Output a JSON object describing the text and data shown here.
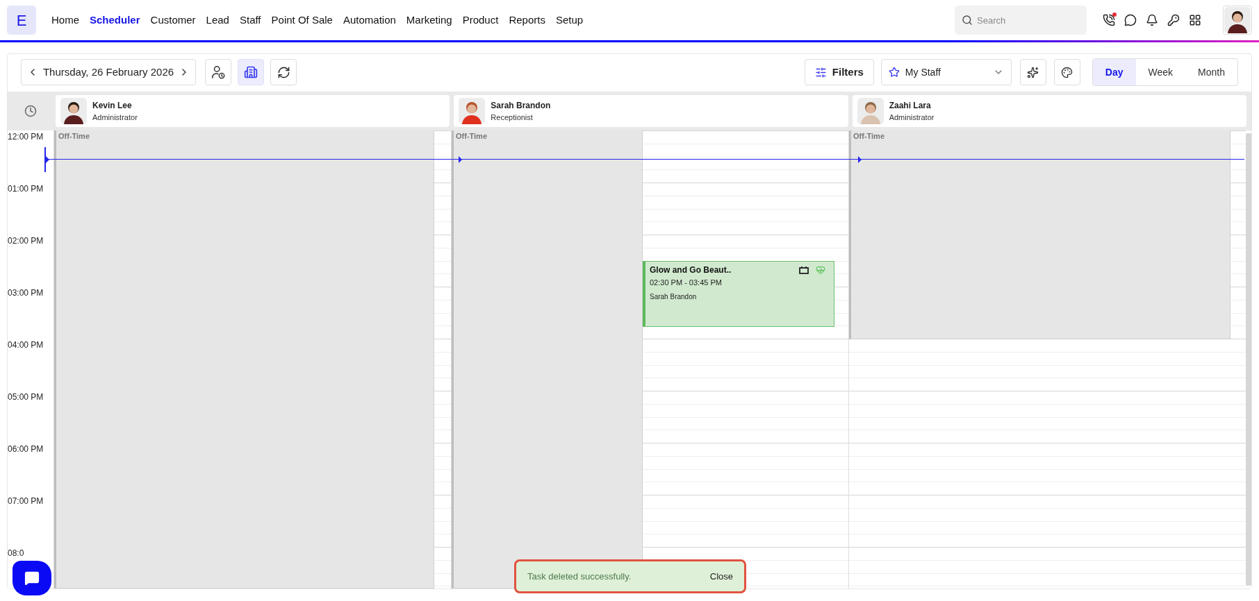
{
  "logo": "E",
  "nav": [
    {
      "label": "Home",
      "selected": false
    },
    {
      "label": "Scheduler",
      "selected": true
    },
    {
      "label": "Customer",
      "selected": false
    },
    {
      "label": "Lead",
      "selected": false
    },
    {
      "label": "Staff",
      "selected": false
    },
    {
      "label": "Point Of Sale",
      "selected": false
    },
    {
      "label": "Automation",
      "selected": false
    },
    {
      "label": "Marketing",
      "selected": false
    },
    {
      "label": "Product",
      "selected": false
    },
    {
      "label": "Reports",
      "selected": false
    },
    {
      "label": "Setup",
      "selected": false
    }
  ],
  "search": {
    "placeholder": "Search"
  },
  "header_icons": [
    {
      "kind": "phone",
      "has_dot": true
    },
    {
      "kind": "chat",
      "has_dot": false
    },
    {
      "kind": "bell",
      "has_dot": false
    },
    {
      "kind": "key",
      "has_dot": false
    },
    {
      "kind": "apps",
      "has_dot": false
    }
  ],
  "toolbar": {
    "date": "Thursday, 26 February 2026",
    "tool_buttons": [
      {
        "kind": "staff-time",
        "selected": false
      },
      {
        "kind": "building",
        "selected": true
      },
      {
        "kind": "refresh",
        "selected": false
      }
    ],
    "filters": "Filters",
    "staff_select": "My Staff",
    "views": [
      {
        "label": "Day",
        "selected": true
      },
      {
        "label": "Week",
        "selected": false
      },
      {
        "label": "Month",
        "selected": false
      }
    ]
  },
  "time_labels": [
    "12:00 PM",
    "01:00 PM",
    "02:00 PM",
    "03:00 PM",
    "04:00 PM",
    "05:00 PM",
    "06:00 PM",
    "07:00 PM",
    "08:0"
  ],
  "staff": [
    {
      "name": "Kevin Lee",
      "role": "Administrator",
      "off_time": "Off-Time"
    },
    {
      "name": "Sarah Brandon",
      "role": "Receptionist",
      "off_time": "Off-Time",
      "events": [
        {
          "title": "Glow and Go Beaut..",
          "time": "02:30 PM - 03:45 PM",
          "person": "Sarah Brandon"
        }
      ]
    },
    {
      "name": "Zaahi Lara",
      "role": "Administrator",
      "off_time": "Off-Time"
    }
  ],
  "toast": {
    "message": "Task deleted successfully.",
    "action": "Close"
  }
}
